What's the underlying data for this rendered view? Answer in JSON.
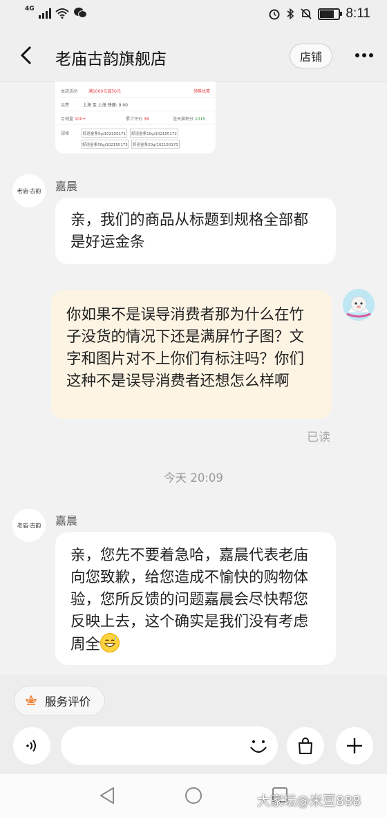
{
  "status_bar": {
    "network": "4G",
    "time": "8:11",
    "battery_level": 0.7,
    "icons": [
      "signal-bars-icon",
      "wifi-icon",
      "wechat-icon",
      "alarm-icon",
      "bluetooth-icon",
      "mute-icon",
      "battery-icon"
    ]
  },
  "header": {
    "title": "老庙古韵旗舰店",
    "store_label": "店铺",
    "icons": [
      "back-arrow-icon",
      "more-dots-icon"
    ]
  },
  "product_card": {
    "promo_label": "本店活动",
    "promo_value": "满1000元减50元",
    "coupon_link": "领券优惠",
    "shipping_label": "运费",
    "shipping_value": "上海 至 上海 快递: 0.00",
    "monthly_sales_label": "月销量",
    "monthly_sales_value": "100+",
    "reviews_label": "累计评价",
    "reviews_value": "38",
    "points_label": "送天猫积分",
    "points_value": "1015",
    "spec_label": "规格",
    "spec_options": [
      "好运金条5g/102150171",
      "好运金条10g/102150172",
      "好运金条50g/102150175",
      "好运金条20g/102150173"
    ]
  },
  "messages": [
    {
      "sender": "嘉晨",
      "avatar_text": "老庙·古韵",
      "direction": "in",
      "text": "亲，我们的商品从标题到规格全部都是好运金条"
    },
    {
      "direction": "out",
      "text": "你如果不是误导消费者那为什么在竹子没货的情况下还是满屏竹子图？文字和图片对不上你们有标注吗？你们这种不是误导消费者还想怎么样啊",
      "status": "已读"
    },
    {
      "divider": "今天  20:09"
    },
    {
      "sender": "嘉晨",
      "avatar_text": "老庙·古韵",
      "direction": "in",
      "text": "亲，您先不要着急哈，嘉晨代表老庙向您致歉，给您造成不愉快的购物体验，您所反馈的问题嘉晨会尽快帮您反映上去，这个确实是我们没有考虑周全",
      "emoji": "grinning-sweat-emoji"
    }
  ],
  "bottom": {
    "service_label": "服务评价",
    "icons": [
      "flower-icon",
      "voice-icon",
      "emoji-face-icon",
      "shopping-bag-icon",
      "plus-icon"
    ]
  },
  "nav": {
    "icons": [
      "back-triangle-icon",
      "home-circle-icon",
      "recents-square-icon"
    ]
  },
  "watermark": "大家坛@米豆888"
}
